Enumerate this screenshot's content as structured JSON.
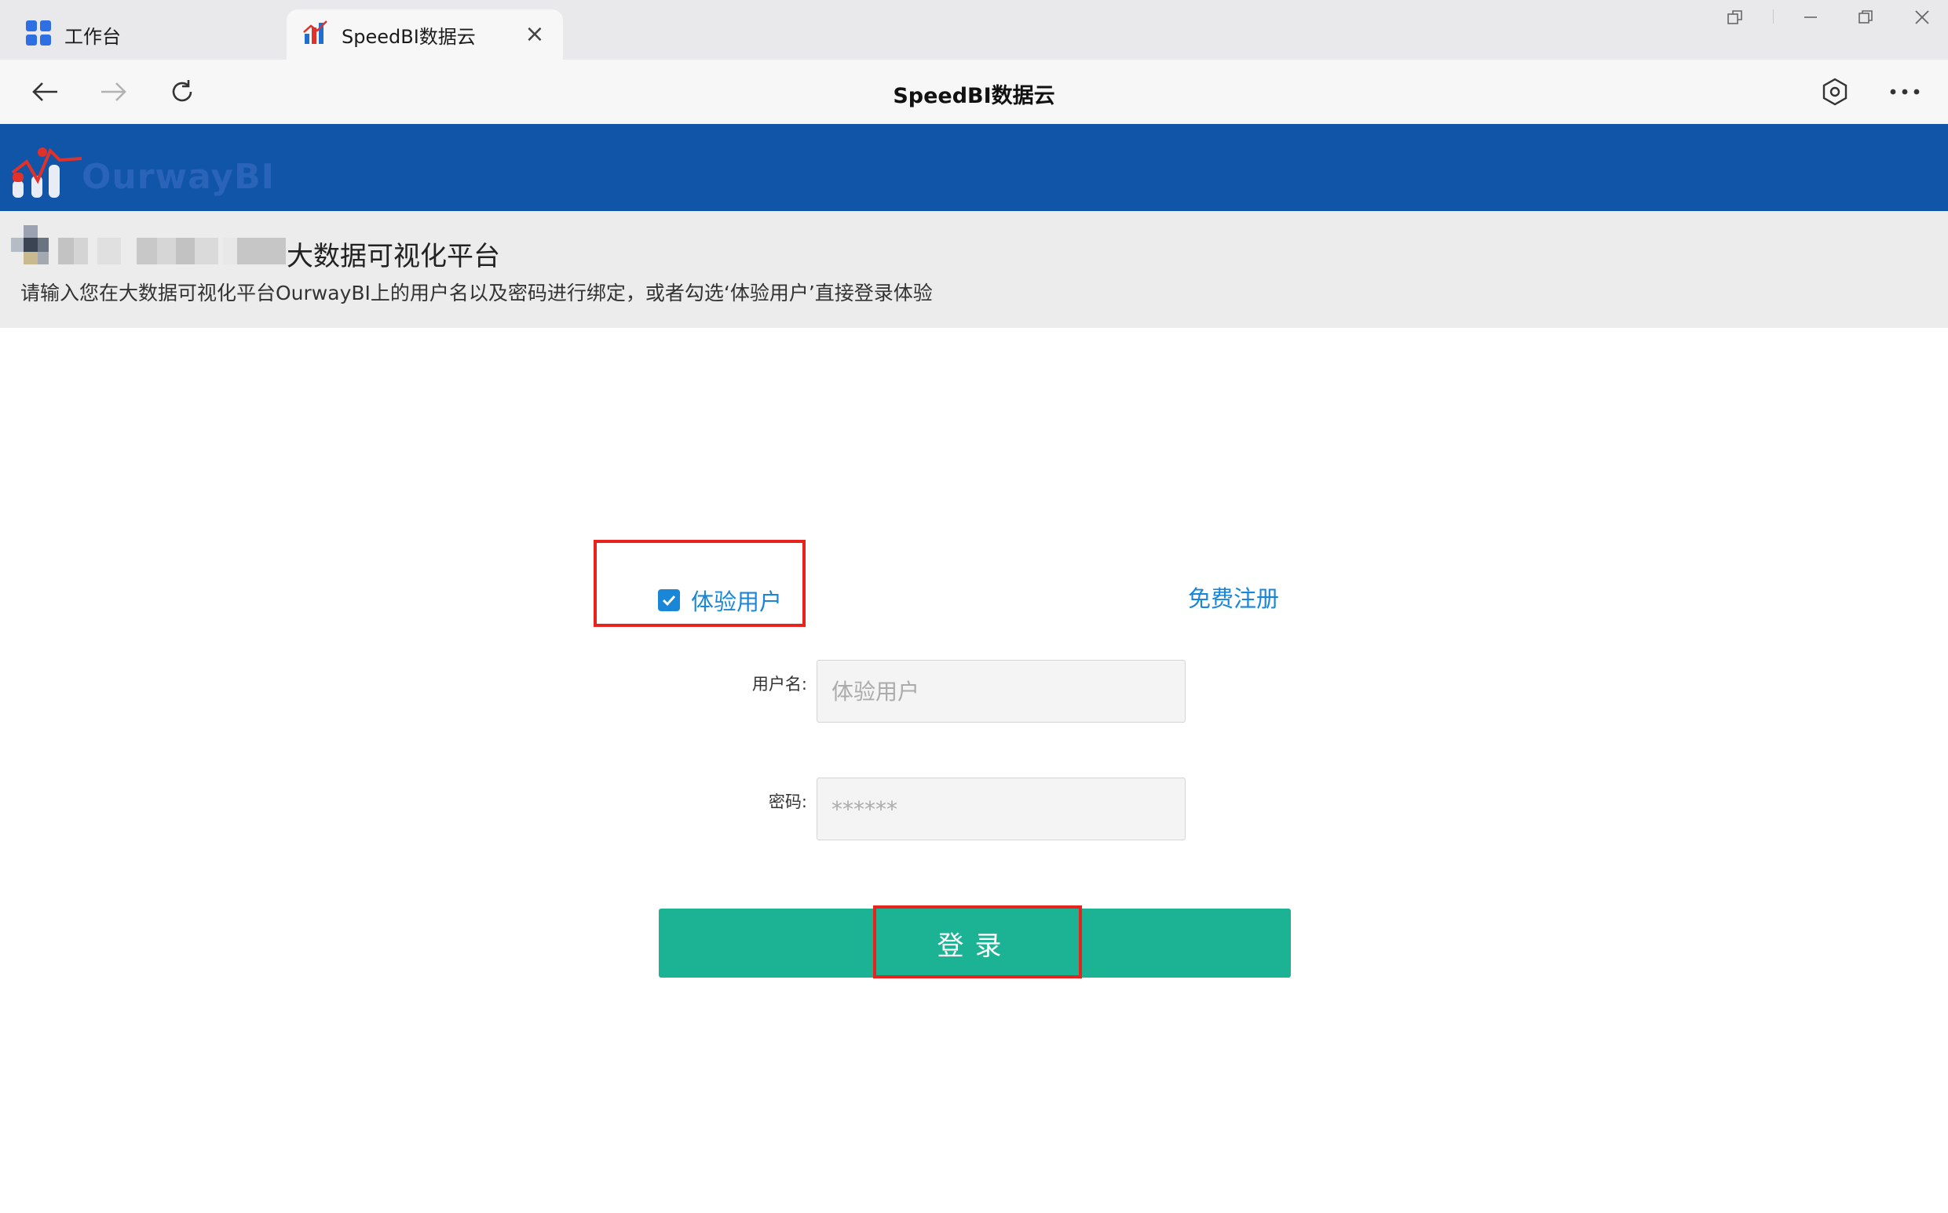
{
  "browser": {
    "tabs": [
      {
        "title": "工作台",
        "icon": "workspace-grid-icon",
        "active": false
      },
      {
        "title": "SpeedBI数据云",
        "icon": "speedbi-icon",
        "active": true
      }
    ],
    "page_title": "SpeedBI数据云"
  },
  "site": {
    "logo_text": "OurwayBI",
    "intro_title": "大数据可视化平台",
    "intro_desc": "请输入您在大数据可视化平台OurwayBI上的用户名以及密码进行绑定，或者勾选‘体验用户’直接登录体验"
  },
  "login": {
    "trial_checkbox_label": "体验用户",
    "trial_checked": true,
    "register_link": "免费注册",
    "username_label": "用户名:",
    "username_placeholder": "体验用户",
    "password_label": "密码:",
    "password_placeholder": "******",
    "submit_label": "登录"
  },
  "colors": {
    "header_blue": "#1055a8",
    "accent_blue": "#1a86d8",
    "button_green": "#1bb394",
    "highlight_red": "#e8221c"
  }
}
